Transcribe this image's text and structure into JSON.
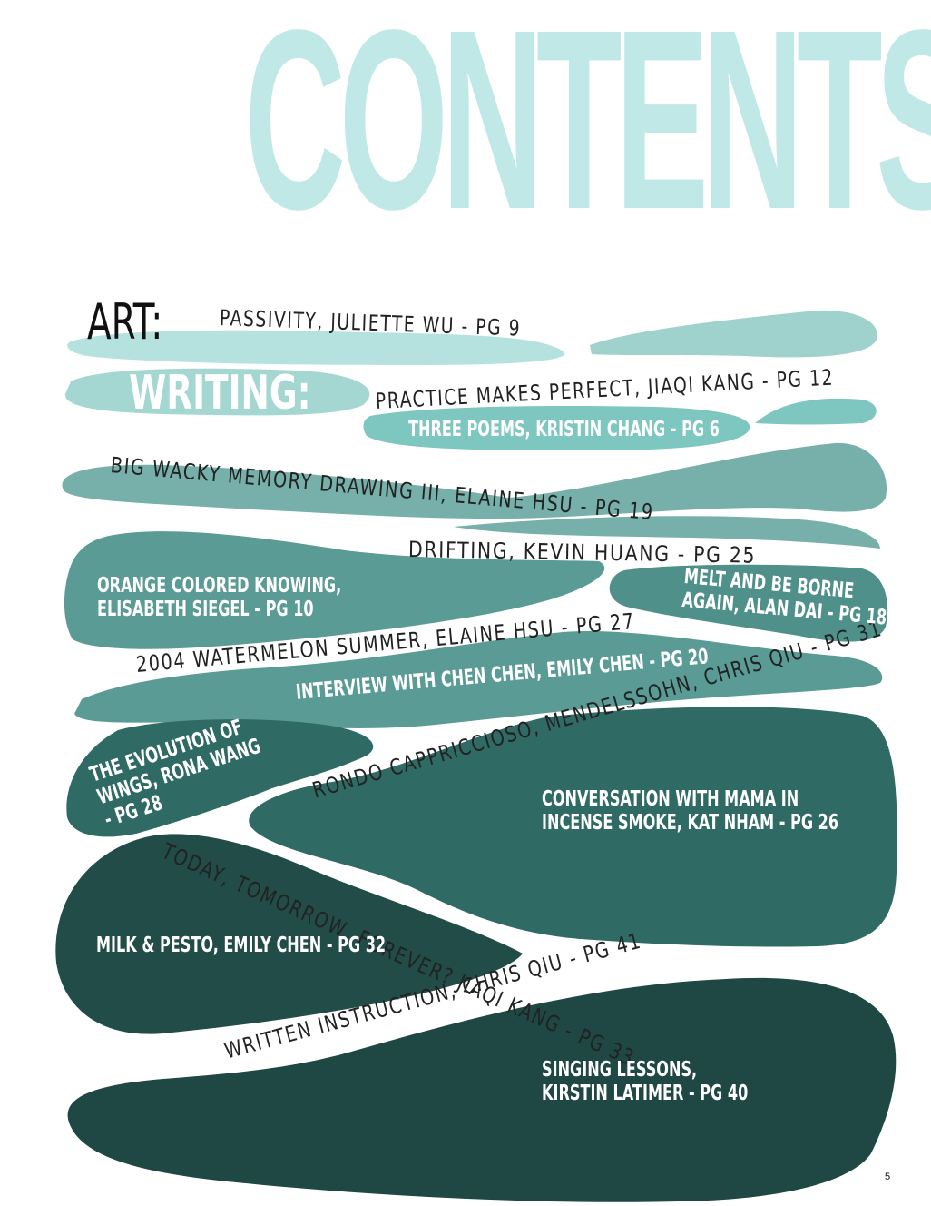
{
  "title": "CONTENTS",
  "sections": {
    "art_label": "ART:",
    "writing_label": "WRITING:"
  },
  "art_items": [
    "PASSIVITY, JULIETTE WU - PG 9",
    "PRACTICE MAKES PERFECT, JIAQI KANG - PG 12",
    "BIG WACKY MEMORY DRAWING III, ELAINE HSU - PG 19",
    "DRIFTING, KEVIN HUANG - PG 25",
    "2004 WATERMELON SUMMER, ELAINE HSU - PG 27",
    "RONDO CAPPRICCIOSO, MENDELSSOHN, CHRIS QIU - PG 31",
    "TODAY, TOMORROW, FOREVER? JIAQI KANG - PG 33",
    "WRITTEN INSTRUCTION, CHRIS QIU - PG 41"
  ],
  "writing_items": {
    "three_poems": "THREE POEMS, KRISTIN CHANG - PG 6",
    "orange": [
      "ORANGE COLORED KNOWING,",
      "ELISABETH SIEGEL - PG 10"
    ],
    "melt": [
      "MELT AND BE BORNE",
      "AGAIN, ALAN DAI - PG 18"
    ],
    "interview": "INTERVIEW WITH CHEN CHEN, EMILY CHEN - PG 20",
    "evolution": [
      "THE EVOLUTION OF",
      "WINGS, RONA WANG",
      "- PG 28"
    ],
    "conversation": [
      "CONVERSATION WITH MAMA IN",
      "INCENSE SMOKE, KAT NHAM - PG 26"
    ],
    "milk": "MILK & PESTO, EMILY CHEN - PG 32",
    "singing": [
      "SINGING LESSONS,",
      "KIRSTIN LATIMER - PG 40"
    ]
  },
  "page_number": "5",
  "colors": {
    "title": "#c0e8e6",
    "band_1": "#b5e2df",
    "band_2": "#9fd2cd",
    "band_3": "#7dc7c0",
    "band_4": "#77b0aa",
    "band_5": "#5a9c95",
    "band_6": "#4f918a",
    "band_7": "#2f6a65",
    "band_8": "#214c47",
    "band_9": "#1f4743"
  }
}
